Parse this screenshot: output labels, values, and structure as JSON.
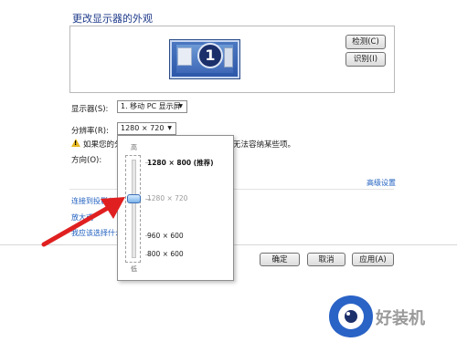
{
  "title": "更改显示器的外观",
  "preview": {
    "monitor_number": "1",
    "detect_label": "检测(C)",
    "identify_label": "识别(I)"
  },
  "display": {
    "label": "显示器(S):",
    "value": "1. 移动 PC 显示屏"
  },
  "resolution": {
    "label": "分辨率(R):",
    "value": "1280 × 720"
  },
  "warning": {
    "text_left": "如果您的分",
    "text_right": "无法容纳某些项。"
  },
  "orientation": {
    "label": "方向(O):"
  },
  "links": {
    "advanced": "高级设置",
    "projector": "连接到投影仪",
    "zoom": "放大或",
    "which_display": "我应该选择什么"
  },
  "dialog_buttons": {
    "ok": "确定",
    "cancel": "取消",
    "apply": "应用(A)"
  },
  "resolution_popup": {
    "high_label": "高",
    "low_label": "低",
    "options": [
      "1280 × 800 (推荐)",
      "1280 × 720",
      "960 × 600",
      "800 × 600"
    ],
    "selected_index": 1
  },
  "watermark": {
    "text": "好装机"
  },
  "colors": {
    "arrow": "#e02020",
    "link": "#1f5fbf",
    "title": "#1e3a8a"
  }
}
